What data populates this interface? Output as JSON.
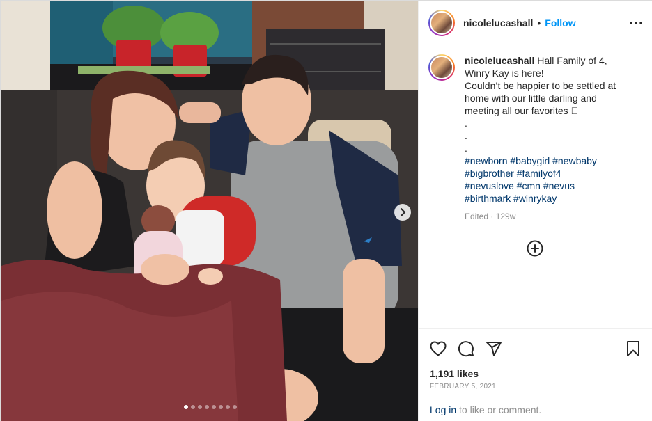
{
  "post": {
    "username": "nicolelucashall",
    "separator": "•",
    "follow_label": "Follow",
    "more_icon": "more-horizontal-icon",
    "caption_lines": [
      "Hall Family of 4,",
      "Winry Kay is here!",
      "Couldn’t be happier to be settled at",
      "home with our little darling and",
      "meeting all our favorites 🏾",
      ".",
      ".",
      "."
    ],
    "hashtag_lines": [
      [
        "#newborn",
        "#babygirl",
        "#newbaby"
      ],
      [
        "#bigbrother",
        "#familyof4"
      ],
      [
        "#nevuslove",
        "#cmn",
        "#nevus"
      ],
      [
        "#birthmark",
        "#winrykay"
      ]
    ],
    "edited_label": "Edited · 129w",
    "load_more_icon": "plus-circle-icon",
    "likes": "1,191 likes",
    "date": "FEBRUARY 5, 2021",
    "login": {
      "link": "Log in",
      "rest": " to like or comment."
    }
  },
  "media": {
    "carousel_count": 8,
    "active_index": 0,
    "next_icon": "chevron-right-icon",
    "description_icons": [
      "photo-icon"
    ]
  },
  "actions": {
    "icons": [
      "heart-icon",
      "comment-icon",
      "share-icon",
      "bookmark-icon"
    ]
  },
  "colors": {
    "link_blue": "#0095f6",
    "hashtag": "#00376b",
    "muted": "#8e8e8e"
  }
}
